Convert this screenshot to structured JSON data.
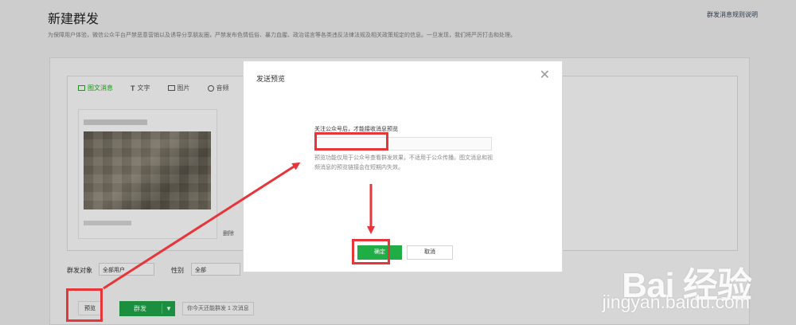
{
  "page": {
    "title": "新建群发",
    "help_link": "群发消息规则说明",
    "notice": "为保障用户体验，微信公众平台严禁恶意营销以及诱导分享朋友圈，严禁发布色情低俗、暴力血腥、政治谣言等各类违反法律法规及相关政策规定的信息。一旦发现，我们将严厉打击和处理。"
  },
  "editor": {
    "tabs": [
      {
        "label": "图文消息",
        "icon": "article-icon"
      },
      {
        "label": "文字",
        "icon": "text-icon"
      },
      {
        "label": "图片",
        "icon": "image-icon"
      },
      {
        "label": "音频",
        "icon": "audio-icon"
      }
    ],
    "delete_label": "删除"
  },
  "targets": {
    "audience_label": "群发对象",
    "audience_value": "全部用户",
    "gender_label": "性别",
    "gender_value": "全部"
  },
  "actions": {
    "preview_label": "预览",
    "send_label": "群发",
    "quota_text": "你今天还能群发 1 次消息"
  },
  "modal": {
    "title": "发送预览",
    "close_icon": "close-icon",
    "field_label": "关注公众号后，才能接收消息预览",
    "input_placeholder": "",
    "hint": "预览功能仅用于公众号查看群发效果，不适用于公众传播。图文消息和视频消息的预览链接会在短期内失效。",
    "confirm_label": "确定",
    "cancel_label": "取消"
  },
  "annotation_color": "#e8353a",
  "watermark": {
    "brand": "Bai 经验",
    "url": "jingyan.baidu.com"
  }
}
